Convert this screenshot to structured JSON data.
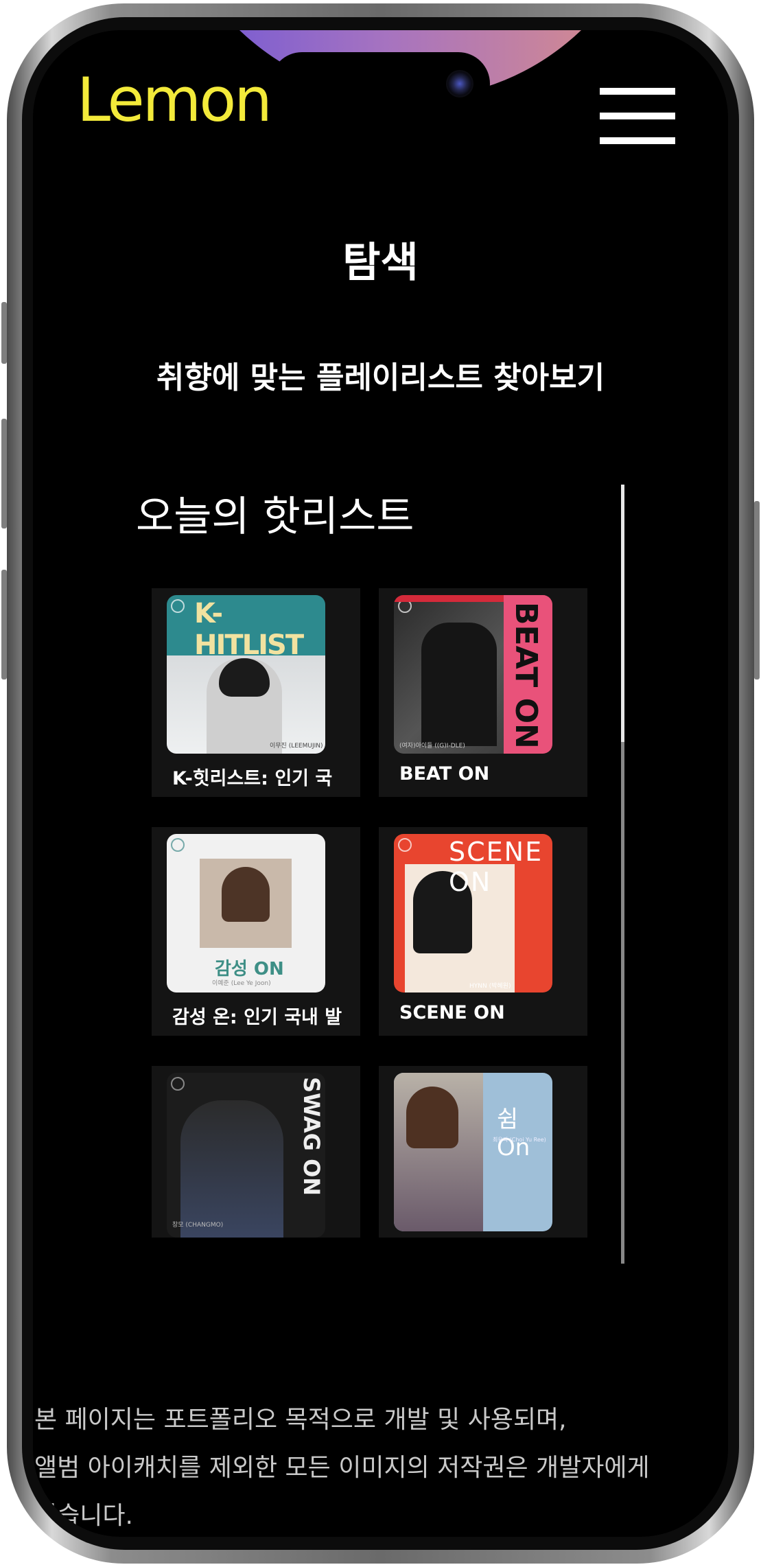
{
  "app": {
    "logo_text": "Lemon",
    "brand_color": "#f3ea3a"
  },
  "header": {
    "menu_icon": "hamburger-menu-icon"
  },
  "page": {
    "title": "탐색",
    "subtitle": "취향에 맞는 플레이리스트 찾아보기",
    "section_title": "오늘의 핫리스트"
  },
  "playlists": [
    {
      "label": "K-힛리스트: 인기 국",
      "cover_text": "K-HITLIST",
      "cover_caption": "이무진 (LEEMUJIN)"
    },
    {
      "label": "BEAT ON",
      "cover_text": "BEAT ON",
      "cover_caption": "(여자)아이들 ((G)I-DLE)"
    },
    {
      "label": "감성 온: 인기 국내 발",
      "cover_text": "감성 ON",
      "cover_caption": "이예준 (Lee Ye Joon)"
    },
    {
      "label": "SCENE ON",
      "cover_text": "SCENE ON",
      "cover_caption": "HYNN (박혜원)"
    },
    {
      "label": "",
      "cover_text": "SWAG ON",
      "cover_caption": "창모 (CHANGMO)"
    },
    {
      "label": "",
      "cover_text": "쉼 On",
      "cover_caption": "최유리 (Choi Yu Ree)"
    }
  ],
  "footer": {
    "line1": "본 페이지는 포트폴리오 목적으로 개발 및 사용되며,",
    "line2": "앨범 아이캐치를 제외한 모든 이미지의 저작권은 개발자에게",
    "line3": "있습니다."
  }
}
